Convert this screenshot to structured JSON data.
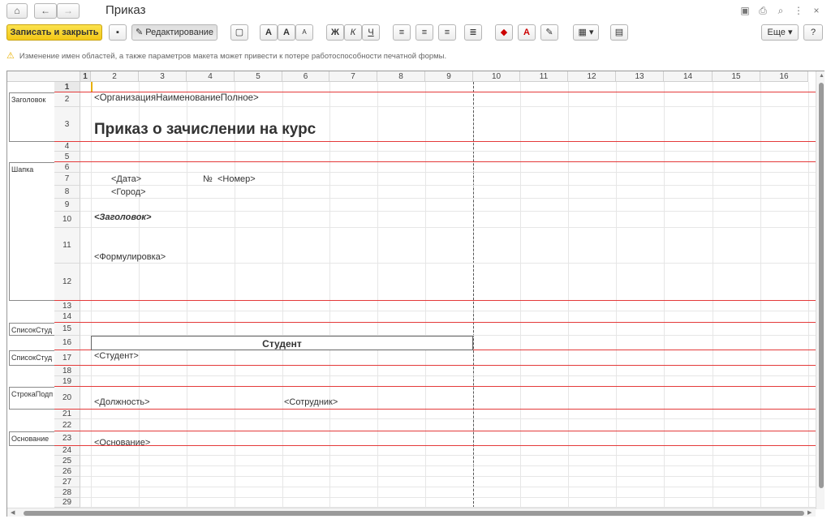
{
  "window": {
    "title": "Приказ"
  },
  "nav": {
    "home_icon": "home-icon",
    "back_icon": "arrow-left-icon",
    "forward_icon": "arrow-right-icon"
  },
  "toolbar": {
    "save_close": "Записать и закрыть",
    "editing": "Редактирование",
    "more": "Еще",
    "help": "?",
    "bold": "Ж",
    "italic": "К",
    "underline": "Ч",
    "font_a": "A",
    "font_grow": "A",
    "font_shrink": "A"
  },
  "warning": {
    "text": "Изменение имен областей, а также параметров макета может привести к потере работоспособности печатной формы."
  },
  "sheet": {
    "columns": [
      "1",
      "2",
      "3",
      "4",
      "5",
      "6",
      "7",
      "8",
      "9",
      "10",
      "11",
      "12",
      "13",
      "14",
      "15",
      "16"
    ],
    "rows": [
      "1",
      "2",
      "3",
      "4",
      "5",
      "6",
      "7",
      "8",
      "9",
      "10",
      "11",
      "12",
      "13",
      "14",
      "15",
      "16",
      "17",
      "18",
      "19",
      "20",
      "21",
      "22",
      "23",
      "24",
      "25",
      "26",
      "27",
      "28",
      "29"
    ],
    "areas": [
      "Заголовок",
      "Шапка",
      "СписокСтуд",
      "СписокСтуд",
      "СтрокаПодп",
      "Основание"
    ],
    "cells": {
      "org": "<ОрганизацияНаименованиеПолное>",
      "title": "Приказ о зачислении на курс",
      "date": "<Дата>",
      "num_sign": "№",
      "number": "<Номер>",
      "city": "<Город>",
      "header": "<Заголовок>",
      "formulation": "<Формулировка>",
      "student_head": "Студент",
      "student": "<Студент>",
      "position": "<Должность>",
      "employee": "<Сотрудник>",
      "basis": "<Основание>"
    }
  },
  "colors": {
    "accent": "#f3c818",
    "region_line": "#e43a3a"
  }
}
